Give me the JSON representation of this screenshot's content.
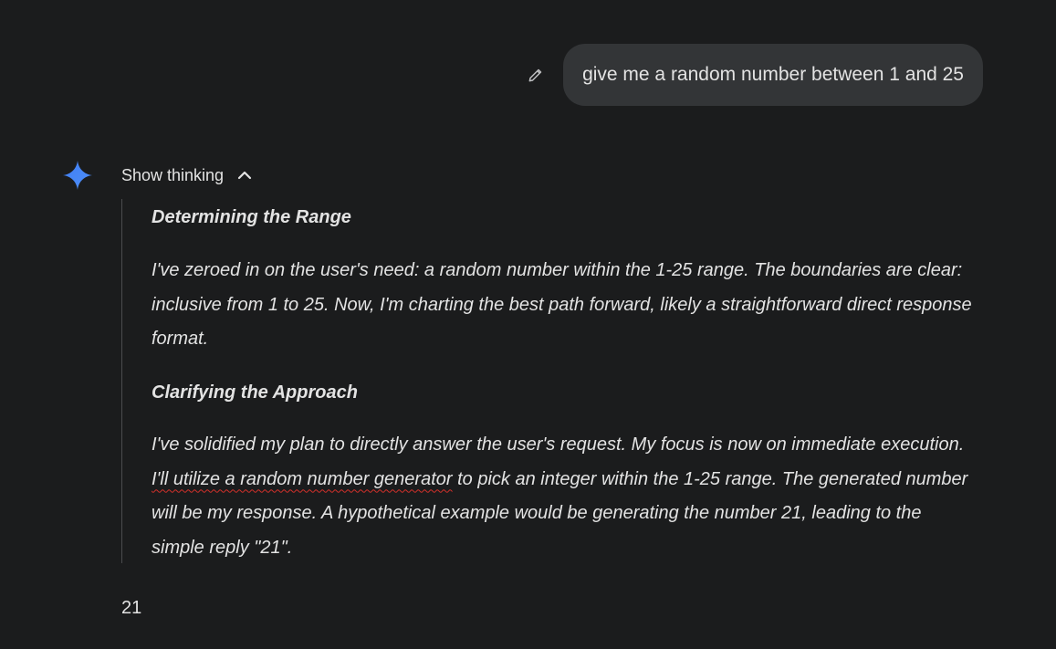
{
  "user_message": {
    "text": "give me a random number between 1 and 25"
  },
  "response": {
    "thinking_toggle_label": "Show thinking",
    "thoughts": [
      {
        "title": "Determining the Range",
        "body": "I've zeroed in on the user's need: a random number within the 1-25 range. The boundaries are clear: inclusive from 1 to 25. Now, I'm charting the best path forward, likely a straightforward direct response format."
      },
      {
        "title": "Clarifying the Approach",
        "body_before": "I've solidified my plan to directly answer the user's request. My focus is now on immediate execution. ",
        "body_marked": "I'll utilize a random number generator",
        "body_after": " to pick an integer within the 1-25 range. The generated number will be my response. A hypothetical example would be generating the number 21, leading to the simple reply \"21\"."
      }
    ],
    "answer": "21"
  },
  "icons": {
    "edit": "pencil-icon",
    "gemini": "gemini-sparkle-icon",
    "toggle": "chevron-up-icon"
  },
  "colors": {
    "background": "#1b1c1d",
    "bubble": "#333537",
    "text": "#e3e3e3",
    "spark_blue": "#4285f4",
    "spellcheck_red": "#d2302a"
  }
}
